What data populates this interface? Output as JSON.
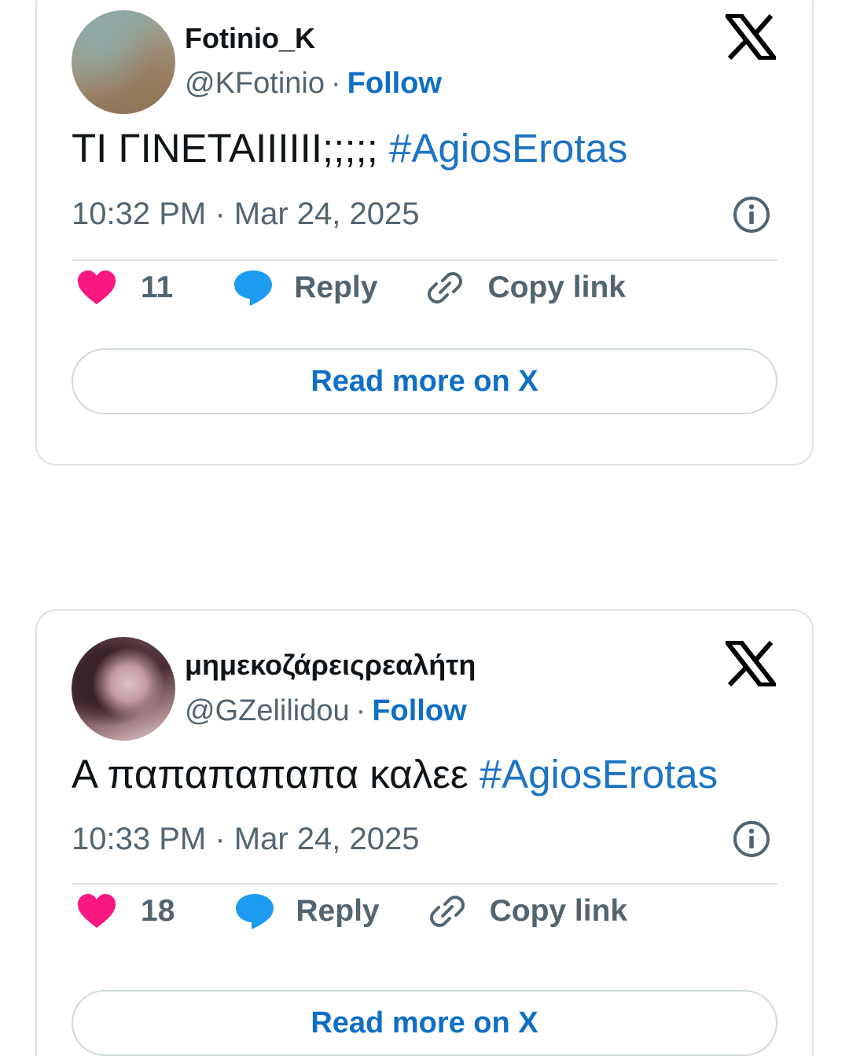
{
  "colors": {
    "like": "#f91880",
    "reply": "#1d9bf0",
    "link": "#0f6fc6",
    "hashtag": "#1d73c4",
    "secondary_text": "#536471",
    "primary_text": "#0f1419",
    "border": "#dde2e6"
  },
  "posts": [
    {
      "display_name": "Fotinio_K",
      "handle": "@KFotinio",
      "separator": "·",
      "follow_label": "Follow",
      "text": "ΤΙ ΓΙΝΕΤΑΙΙΙΙΙΙ;;;;;",
      "hashtag": "#AgiosErotas",
      "timestamp": "10:32 PM · Mar 24, 2025",
      "like_count": "11",
      "reply_label": "Reply",
      "copy_link_label": "Copy link",
      "read_more_label": "Read more on X",
      "icons": {
        "brand": "x-logo-icon",
        "info": "info-icon",
        "like": "heart-icon",
        "reply": "speech-bubble-icon",
        "copy": "link-icon"
      }
    },
    {
      "display_name": "μημεκοζάρειςρεαλήτη",
      "handle": "@GZelilidou",
      "separator": "·",
      "follow_label": "Follow",
      "text": "Α παπαπαπαπα καλεε",
      "hashtag": "#AgiosErotas",
      "timestamp": "10:33 PM · Mar 24, 2025",
      "like_count": "18",
      "reply_label": "Reply",
      "copy_link_label": "Copy link",
      "read_more_label": "Read more on X",
      "icons": {
        "brand": "x-logo-icon",
        "info": "info-icon",
        "like": "heart-icon",
        "reply": "speech-bubble-icon",
        "copy": "link-icon"
      }
    }
  ]
}
